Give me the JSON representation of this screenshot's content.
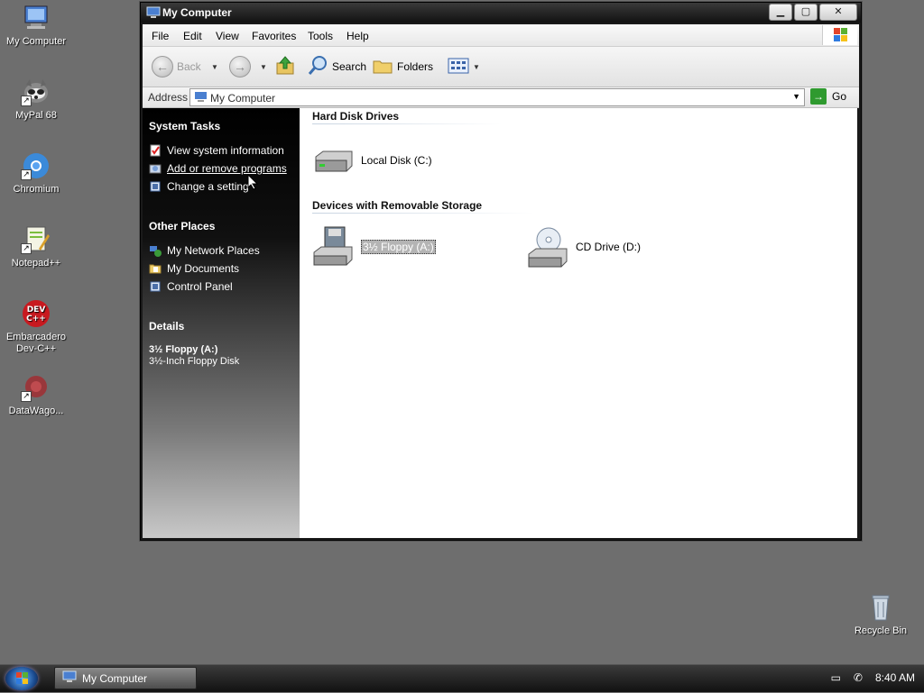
{
  "desktop": {
    "icons": [
      {
        "label": "My Computer"
      },
      {
        "label": "MyPal 68"
      },
      {
        "label": "Chromium"
      },
      {
        "label": "Notepad++"
      },
      {
        "label": "Embarcadero Dev-C++"
      },
      {
        "label": "DataWago..."
      },
      {
        "label": "Recycle Bin"
      }
    ]
  },
  "window": {
    "title": "My Computer",
    "menu": [
      "File",
      "Edit",
      "View",
      "Favorites",
      "Tools",
      "Help"
    ],
    "toolbar": {
      "back": "Back",
      "search": "Search",
      "folders": "Folders"
    },
    "address": {
      "label": "Address",
      "value": "My Computer",
      "go": "Go"
    }
  },
  "left_pane": {
    "system_tasks": {
      "title": "System Tasks",
      "items": [
        "View system information",
        "Add or remove programs",
        "Change a setting"
      ]
    },
    "other_places": {
      "title": "Other Places",
      "items": [
        "My Network Places",
        "My Documents",
        "Control Panel"
      ]
    },
    "details": {
      "title": "Details",
      "name": "3½ Floppy (A:)",
      "type": "3½-Inch Floppy Disk"
    }
  },
  "content": {
    "groups": [
      {
        "title": "Hard Disk Drives",
        "items": [
          "Local Disk (C:)"
        ]
      },
      {
        "title": "Devices with Removable Storage",
        "items": [
          "3½ Floppy (A:)",
          "CD Drive (D:)"
        ]
      }
    ]
  },
  "taskbar": {
    "task": "My Computer",
    "clock": "8:40 AM"
  }
}
